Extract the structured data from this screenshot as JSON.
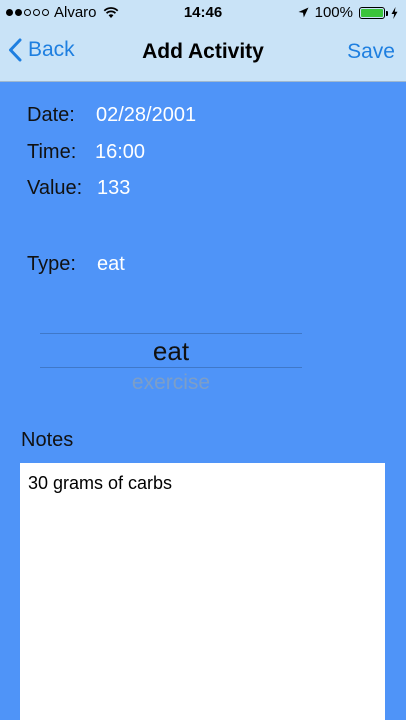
{
  "status_bar": {
    "carrier": "Alvaro",
    "time": "14:46",
    "battery_percent": "100%",
    "signal_bars_filled": 2,
    "signal_bars_total": 5,
    "icons": [
      "wifi-icon",
      "location-arrow-icon",
      "battery-icon",
      "charging-bolt-icon"
    ]
  },
  "nav": {
    "back_label": "Back",
    "title": "Add Activity",
    "save_label": "Save"
  },
  "form": {
    "date_label": "Date:",
    "date_value": "02/28/2001",
    "time_label": "Time:",
    "time_value": "16:00",
    "value_label": "Value:",
    "value_value": "133",
    "type_label": "Type:",
    "type_value": "eat"
  },
  "picker": {
    "options": [
      "eat",
      "exercise"
    ],
    "selected": "eat",
    "next": "exercise"
  },
  "notes": {
    "label": "Notes",
    "text": "30 grams of carbs"
  },
  "colors": {
    "background": "#4f94f8",
    "bar": "#c9e3f7",
    "accent": "#1e7fe0",
    "battery": "#3bc43b"
  }
}
